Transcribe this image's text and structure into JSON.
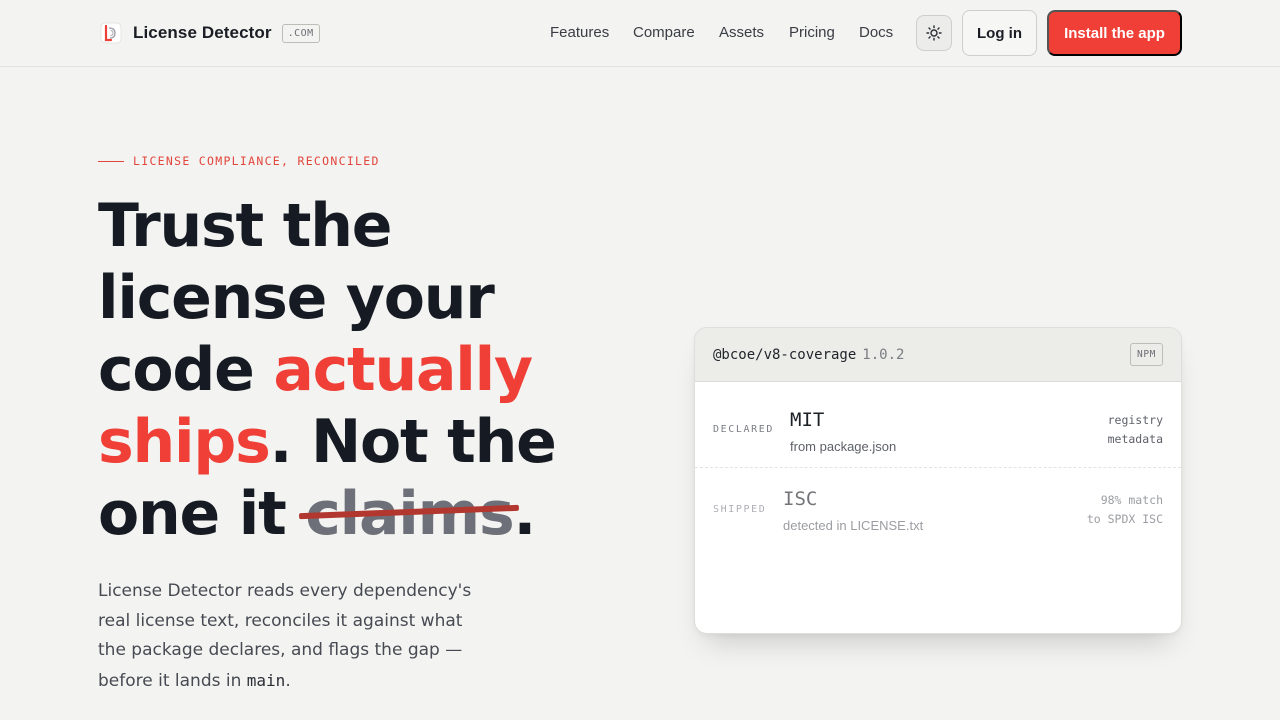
{
  "nav": {
    "brand_name": "License Detector",
    "brand_tld": ".COM",
    "links": [
      "Features",
      "Compare",
      "Assets",
      "Pricing",
      "Docs"
    ],
    "theme_icon": "sun-icon",
    "login_label": "Log in",
    "install_label": "Install the app"
  },
  "hero": {
    "eyebrow": "LICENSE COMPLIANCE, RECONCILED",
    "headline": {
      "line1": "Trust the",
      "line2": "license your",
      "line3a": "code ",
      "line3b": "actually",
      "line4a": "ships",
      "line4b": ". Not the",
      "line5a": "one it ",
      "line5b": "claims",
      "line5c": "."
    },
    "lede_text": "License Detector reads every dependency's real license text, reconciles it against what the package declares, and flags the gap — before it lands in ",
    "lede_code": "main",
    "lede_end": "."
  },
  "card": {
    "package": "@bcoe/v8-coverage",
    "version": "1.0.2",
    "badge": "NPM",
    "rows": [
      {
        "label": "DECLARED",
        "license": "MIT",
        "source": "from package.json",
        "meta1": "registry",
        "meta2": "metadata"
      },
      {
        "label": "SHIPPED",
        "license": "ISC",
        "source": "detected in LICENSE.txt",
        "meta1": "98% match",
        "meta2": "to SPDX ISC"
      }
    ]
  },
  "colors": {
    "accent": "#ef3f36",
    "background": "#f3f3f1",
    "text": "#161a22"
  }
}
